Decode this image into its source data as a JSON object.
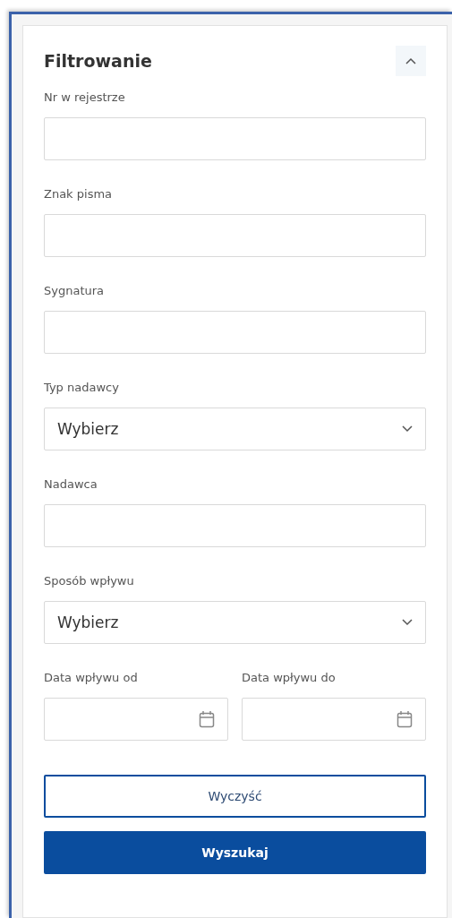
{
  "panel": {
    "title": "Filtrowanie",
    "expanded": true
  },
  "fields": [
    {
      "kind": "text",
      "label": "Nr w rejestrze"
    },
    {
      "kind": "text",
      "label": "Znak pisma"
    },
    {
      "kind": "text",
      "label": "Sygnatura"
    },
    {
      "kind": "select",
      "label": "Typ nadawcy",
      "value": "Wybierz"
    },
    {
      "kind": "text",
      "label": "Nadawca"
    },
    {
      "kind": "select",
      "label": "Sposób wpływu",
      "value": "Wybierz"
    }
  ],
  "date_fields": [
    {
      "label": "Data wpływu od"
    },
    {
      "label": "Data wpływu do"
    }
  ],
  "buttons": [
    {
      "kind": "secondary",
      "label": "Wyczyść"
    },
    {
      "kind": "primary",
      "label": "Wyszukaj"
    }
  ]
}
